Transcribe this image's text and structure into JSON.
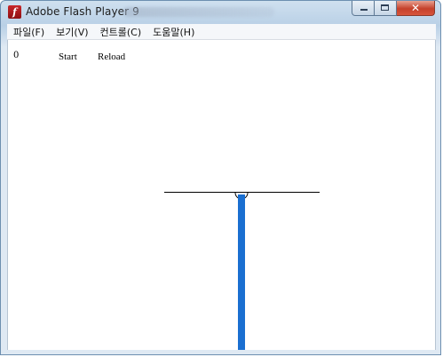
{
  "window": {
    "title": "Adobe Flash Player 9",
    "close_glyph": "✕"
  },
  "menu": {
    "items": [
      {
        "label": "파일(F)"
      },
      {
        "label": "보기(V)"
      },
      {
        "label": "컨트롤(C)"
      },
      {
        "label": "도움말(H)"
      }
    ]
  },
  "content": {
    "counter": "0",
    "start_label": "Start",
    "reload_label": "Reload"
  },
  "colors": {
    "pole": "#1a6fd1",
    "beam": "#000000"
  },
  "icons": {
    "app": "flash-player-icon",
    "minimize": "minimize-icon",
    "maximize": "maximize-icon",
    "close": "close-icon"
  }
}
